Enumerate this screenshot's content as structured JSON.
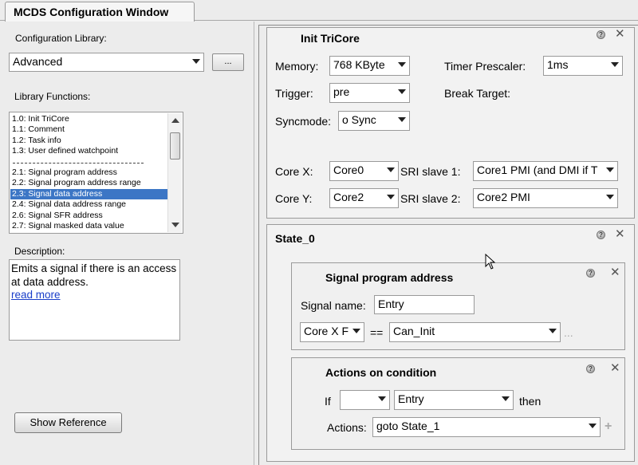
{
  "window": {
    "title": "MCDS Configuration Window"
  },
  "left": {
    "config_library_label": "Configuration Library:",
    "config_library_value": "Advanced",
    "browse_button_label": "...",
    "library_functions_label": "Library Functions:",
    "functions": [
      "1.0: Init TriCore",
      "1.1: Comment",
      "1.2: Task info",
      "1.3: User defined watchpoint",
      "",
      "2.1: Signal program address",
      "2.2: Signal program address range",
      "2.3: Signal data address",
      "2.4: Signal data address range",
      "2.6: Signal SFR address",
      "2.7: Signal masked data value"
    ],
    "selected_function": "2.3: Signal data address",
    "description_label": "Description:",
    "description_text": "Emits a signal if there is an access at data address.",
    "read_more_label": "read more",
    "show_reference_label": "Show Reference"
  },
  "init": {
    "title": "Init TriCore",
    "memory_label": "Memory:",
    "memory_value": "768 KByte",
    "timer_label": "Timer Prescaler:",
    "timer_value": "1ms",
    "trigger_label": "Trigger:",
    "trigger_value": "pre",
    "break_label": "Break Target:",
    "syncmode_label": "Syncmode:",
    "syncmode_value": "o Sync",
    "corex_label": "Core X:",
    "corex_value": "Core0",
    "sri1_label": "SRI slave 1:",
    "sri1_value": "Core1 PMI (and DMI if T",
    "corey_label": "Core Y:",
    "corey_value": "Core2",
    "sri2_label": "SRI slave 2:",
    "sri2_value": "Core2 PMI"
  },
  "state": {
    "title": "State_0",
    "signal": {
      "title": "Signal program address",
      "name_label": "Signal name:",
      "name_value": "Entry",
      "core_value": "Core X F",
      "op": "==",
      "address_value": "Can_Init",
      "more": "..."
    },
    "actions": {
      "title": "Actions on condition",
      "if_label": "If",
      "if_value": "",
      "entry_value": "Entry",
      "then_label": "then",
      "actions_label": "Actions:",
      "actions_value": "goto State_1",
      "add_symbol": "+"
    }
  },
  "icons": {
    "help": "help-icon",
    "close": "close-icon",
    "dropdown": "chevron-down-icon",
    "cursor": "mouse-cursor-icon"
  },
  "colors": {
    "selection": "#3c76c5",
    "link": "#1a3ec9"
  }
}
